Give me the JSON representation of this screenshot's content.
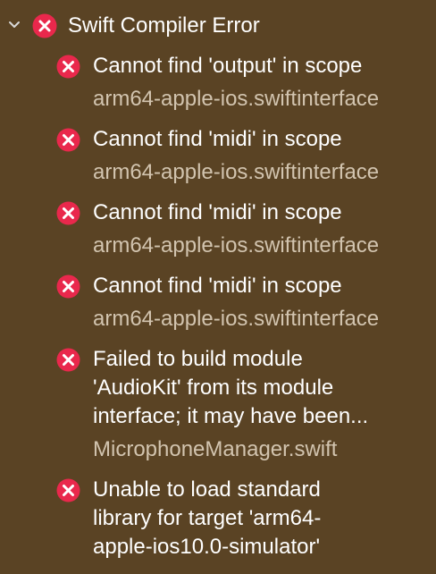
{
  "colors": {
    "background": "#5a4324",
    "primary_text": "#ffffff",
    "secondary_text": "#d2c4af",
    "error_red": "#e9284c"
  },
  "icons": {
    "expand": "chevron-down-icon",
    "error": "error-icon"
  },
  "group": {
    "title": "Swift Compiler Error"
  },
  "issues": [
    {
      "lines": [
        "Cannot find 'output' in scope"
      ],
      "location": "arm64-apple-ios.swiftinterface"
    },
    {
      "lines": [
        "Cannot find 'midi' in scope"
      ],
      "location": "arm64-apple-ios.swiftinterface"
    },
    {
      "lines": [
        "Cannot find 'midi' in scope"
      ],
      "location": "arm64-apple-ios.swiftinterface"
    },
    {
      "lines": [
        "Cannot find 'midi' in scope"
      ],
      "location": "arm64-apple-ios.swiftinterface"
    },
    {
      "lines": [
        "Failed to build module",
        "'AudioKit' from its module",
        "interface; it may have been..."
      ],
      "location": "MicrophoneManager.swift"
    },
    {
      "lines": [
        "Unable to load standard",
        "library for target 'arm64-",
        "apple-ios10.0-simulator'"
      ]
    }
  ]
}
